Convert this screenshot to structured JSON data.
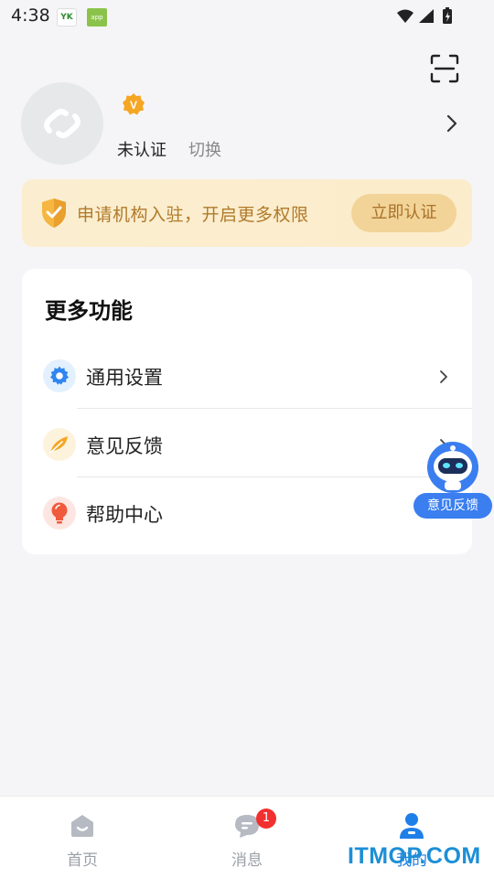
{
  "status_bar": {
    "time": "4:38",
    "notif_icon_1": "YK",
    "notif_icon_2": "app"
  },
  "header": {
    "scan_icon": "scan-icon"
  },
  "profile": {
    "badge_text": "V",
    "status_text": "未认证",
    "switch_label": "切换"
  },
  "banner": {
    "text": "申请机构入驻，开启更多权限",
    "button_label": "立即认证",
    "colors": {
      "bg": "#fbeed0",
      "text": "#b07a2a",
      "button_bg": "#f2d498"
    }
  },
  "more_functions": {
    "title": "更多功能",
    "items": [
      {
        "label": "通用设置",
        "icon": "gear-icon",
        "icon_color": "#2f86f0"
      },
      {
        "label": "意见反馈",
        "icon": "feather-icon",
        "icon_color": "#f5a623"
      },
      {
        "label": "帮助中心",
        "icon": "lightbulb-icon",
        "icon_color": "#f05a3c"
      }
    ]
  },
  "floating_feedback": {
    "label": "意见反馈",
    "icon": "robot-icon"
  },
  "bottom_nav": {
    "items": [
      {
        "label": "首页",
        "icon": "home-icon",
        "active": false
      },
      {
        "label": "消息",
        "icon": "message-icon",
        "active": false,
        "badge": "1"
      },
      {
        "label": "我的",
        "icon": "user-icon",
        "active": true
      }
    ],
    "active_color": "#1e7fe8"
  },
  "watermark": "ITMOP.COM"
}
